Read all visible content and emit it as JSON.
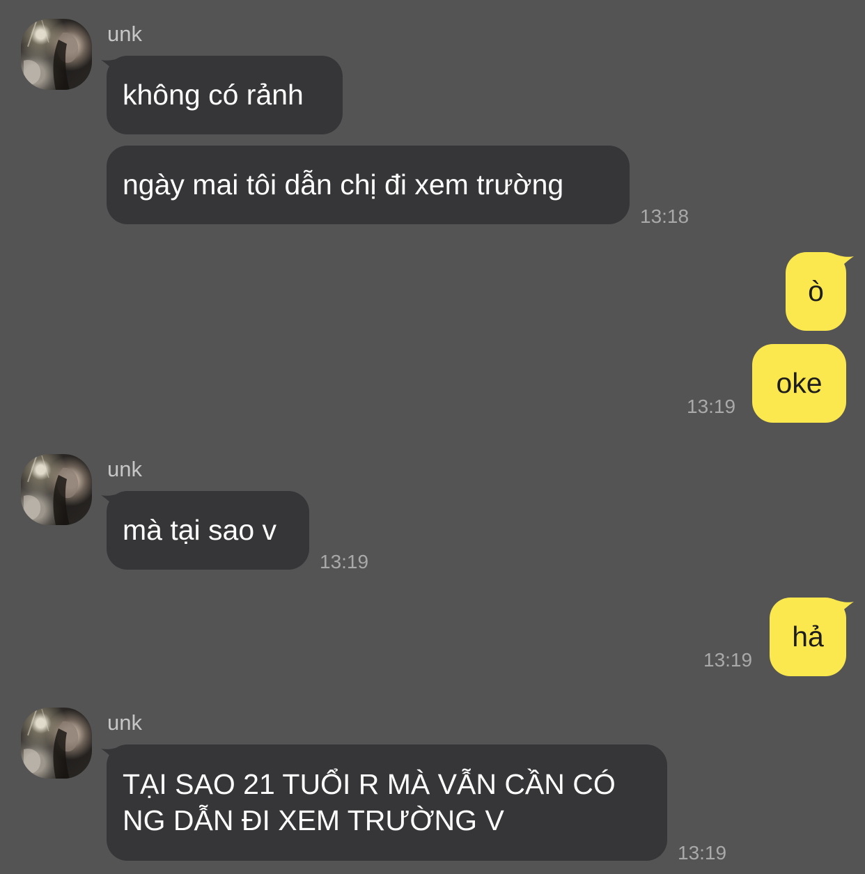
{
  "conversation": {
    "sender_name": "unk",
    "groups": [
      {
        "sender": "unk",
        "messages": [
          {
            "text": "không có rảnh"
          },
          {
            "text": "ngày mai tôi dẫn chị đi xem trường",
            "time": "13:18"
          }
        ]
      },
      {
        "sender": "me",
        "messages": [
          {
            "text": "ò"
          },
          {
            "text": "oke",
            "time": "13:19"
          }
        ]
      },
      {
        "sender": "unk",
        "messages": [
          {
            "text": "mà tại sao v",
            "time": "13:19"
          }
        ]
      },
      {
        "sender": "me",
        "messages": [
          {
            "text": "hả",
            "time": "13:19"
          }
        ]
      },
      {
        "sender": "unk",
        "messages": [
          {
            "line1": "TẠI SAO 21 TUỔI R MÀ VẪN CẦN CÓ",
            "line2": "NG DẪN ĐI XEM TRƯỜNG V",
            "time": "13:19"
          }
        ]
      }
    ]
  },
  "colors": {
    "background": "#555455",
    "incoming_bubble": "#363638",
    "outgoing_bubble": "#fbe84e",
    "timestamp": "#a9a9a9",
    "sender_name": "#c6c6c6"
  },
  "icons": {
    "avatar": "profile-photo-avatar"
  }
}
